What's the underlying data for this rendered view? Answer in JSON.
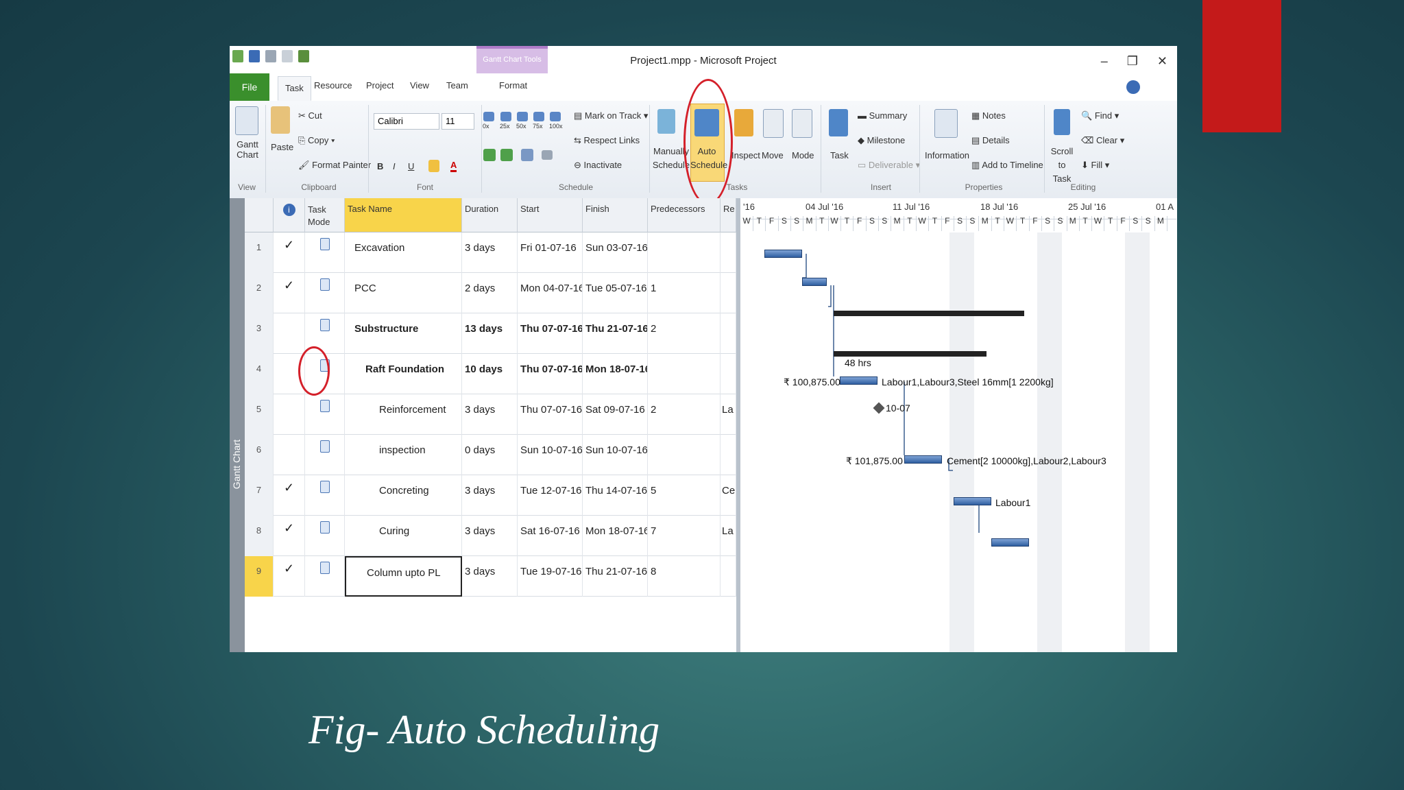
{
  "window": {
    "title": "Project1.mpp - Microsoft Project",
    "contextual_group": "Gantt Chart Tools"
  },
  "tabs": [
    "File",
    "Task",
    "Resource",
    "Project",
    "View",
    "Team",
    "Format"
  ],
  "ribbon": {
    "view": {
      "gantt": "Gantt Chart",
      "label": "View"
    },
    "clipboard": {
      "paste": "Paste",
      "cut": "Cut",
      "copy": "Copy",
      "format_painter": "Format Painter",
      "label": "Clipboard"
    },
    "font": {
      "name": "Calibri",
      "size": "11",
      "label": "Font"
    },
    "schedule": {
      "mark_on_track": "Mark on Track",
      "respect_links": "Respect Links",
      "inactivate": "Inactivate",
      "label": "Schedule",
      "pct": [
        "0x",
        "25x",
        "50x",
        "75x",
        "100x"
      ]
    },
    "tasks": {
      "manually": "Manually Schedule",
      "auto": "Auto Schedule",
      "inspect": "Inspect",
      "move": "Move",
      "mode": "Mode",
      "label": "Tasks"
    },
    "insert": {
      "task": "Task",
      "summary": "Summary",
      "milestone": "Milestone",
      "deliverable": "Deliverable",
      "label": "Insert"
    },
    "properties": {
      "information": "Information",
      "notes": "Notes",
      "details": "Details",
      "add_to_timeline": "Add to Timeline",
      "label": "Properties"
    },
    "editing": {
      "scroll": "Scroll to Task",
      "find": "Find",
      "clear": "Clear",
      "fill": "Fill",
      "label": "Editing"
    }
  },
  "side_tab": "Gantt Chart",
  "columns": {
    "mode": "Task Mode",
    "name": "Task Name",
    "duration": "Duration",
    "start": "Start",
    "finish": "Finish",
    "pred": "Predecessors",
    "res": "Re"
  },
  "rows": [
    {
      "id": "1",
      "ind": "✓",
      "name": "Excavation",
      "dur": "3 days",
      "start": "Fri 01-07-16",
      "finish": "Sun 03-07-16",
      "pred": "",
      "res": ""
    },
    {
      "id": "2",
      "ind": "✓",
      "name": "PCC",
      "dur": "2 days",
      "start": "Mon 04-07-16",
      "finish": "Tue 05-07-16",
      "pred": "1",
      "res": ""
    },
    {
      "id": "3",
      "ind": "",
      "name": "Substructure",
      "dur": "13 days",
      "start": "Thu 07-07-16",
      "finish": "Thu 21-07-16",
      "pred": "2",
      "res": ""
    },
    {
      "id": "4",
      "ind": "",
      "name": "Raft Foundation",
      "dur": "10 days",
      "start": "Thu 07-07-16",
      "finish": "Mon 18-07-16",
      "pred": "",
      "res": ""
    },
    {
      "id": "5",
      "ind": "",
      "name": "Reinforcement",
      "dur": "3 days",
      "start": "Thu 07-07-16",
      "finish": "Sat 09-07-16",
      "pred": "2",
      "res": "La"
    },
    {
      "id": "6",
      "ind": "",
      "name": "inspection",
      "dur": "0 days",
      "start": "Sun 10-07-16",
      "finish": "Sun 10-07-16",
      "pred": "",
      "res": ""
    },
    {
      "id": "7",
      "ind": "✓",
      "name": "Concreting",
      "dur": "3 days",
      "start": "Tue 12-07-16",
      "finish": "Thu 14-07-16",
      "pred": "5",
      "res": "Ce"
    },
    {
      "id": "8",
      "ind": "✓",
      "name": "Curing",
      "dur": "3 days",
      "start": "Sat 16-07-16",
      "finish": "Mon 18-07-16",
      "pred": "7",
      "res": "La"
    },
    {
      "id": "9",
      "ind": "✓",
      "name": "Column upto PL",
      "dur": "3 days",
      "start": "Tue 19-07-16",
      "finish": "Thu 21-07-16",
      "pred": "8",
      "res": ""
    }
  ],
  "timescale": {
    "weeks": [
      "'16",
      "04 Jul '16",
      "11 Jul '16",
      "18 Jul '16",
      "25 Jul '16",
      "01 A"
    ],
    "days": [
      "W",
      "T",
      "F",
      "S",
      "S",
      "M",
      "T",
      "W",
      "T",
      "F",
      "S",
      "S",
      "M",
      "T",
      "W",
      "T",
      "F",
      "S",
      "S",
      "M",
      "T",
      "W",
      "T",
      "F",
      "S",
      "S",
      "M",
      "T",
      "W",
      "T",
      "F",
      "S",
      "S",
      "M"
    ]
  },
  "bar_labels": {
    "lag": "48 hrs",
    "reinf_cost": "₹ 100,875.00",
    "reinf_res": "Labour1,Labour3,Steel 16mm[1 2200kg]",
    "milestone": "10-07",
    "conc_cost": "₹ 101,875.00",
    "conc_res": "Cement[2 10000kg],Labour2,Labour3",
    "curing_res": "Labour1"
  },
  "caption": "Fig- Auto Scheduling"
}
